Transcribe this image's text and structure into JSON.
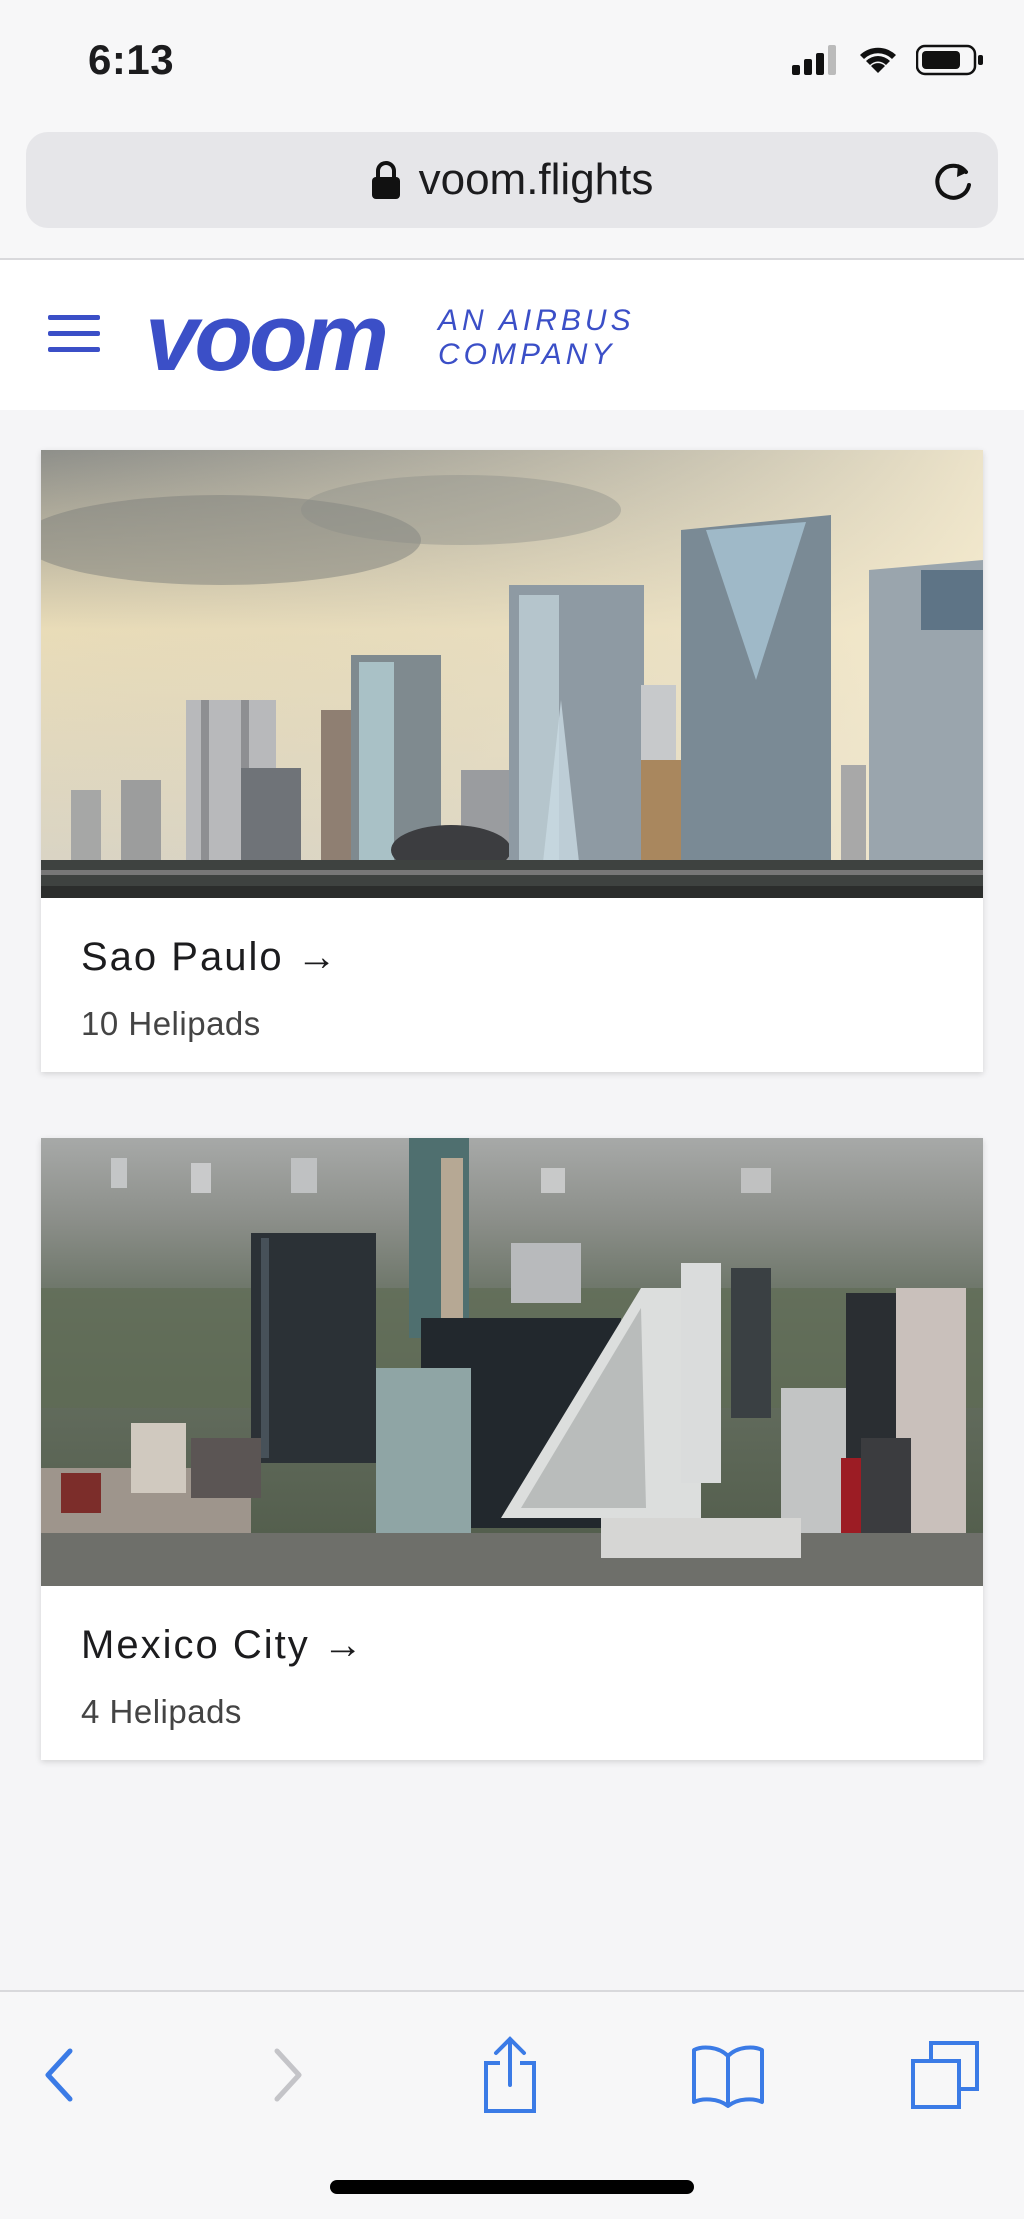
{
  "status_bar": {
    "time": "6:13"
  },
  "browser": {
    "url": "voom.flights"
  },
  "site": {
    "logo": "voom",
    "tagline_line1": "AN AIRBUS",
    "tagline_line2": "COMPANY"
  },
  "cities": [
    {
      "name": "Sao Paulo",
      "arrow": "→",
      "helipads": "10 Helipads"
    },
    {
      "name": "Mexico City",
      "arrow": "→",
      "helipads": "4 Helipads"
    }
  ],
  "colors": {
    "brand": "#3b4fc7",
    "ios_blue": "#3b7be6"
  },
  "toolbar": {
    "icons": [
      "back-icon",
      "forward-icon",
      "share-icon",
      "bookmarks-icon",
      "tabs-icon"
    ]
  }
}
